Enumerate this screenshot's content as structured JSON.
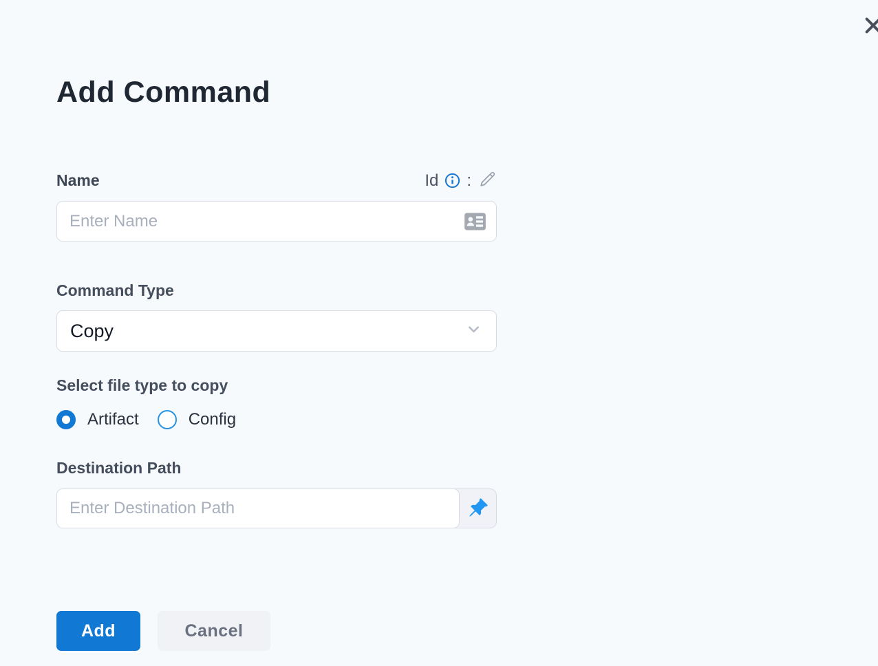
{
  "panel": {
    "title": "Add Command"
  },
  "form": {
    "name": {
      "label": "Name",
      "id_prefix": "Id",
      "id_separator": ":",
      "placeholder": "Enter Name",
      "value": ""
    },
    "command_type": {
      "label": "Command Type",
      "selected_value": "Copy"
    },
    "file_type": {
      "label": "Select file type to copy",
      "options": [
        {
          "label": "Artifact",
          "selected": true
        },
        {
          "label": "Config",
          "selected": false
        }
      ]
    },
    "destination_path": {
      "label": "Destination Path",
      "placeholder": "Enter Destination Path",
      "value": ""
    }
  },
  "actions": {
    "add": "Add",
    "cancel": "Cancel"
  },
  "icons": {
    "close": "close-icon (x)",
    "info": "info-circle-icon (blue outlined i)",
    "edit": "pencil-icon (gray outline)",
    "idcard": "idcard-icon (gray contact card suffix)",
    "chevron": "chevron-down-icon",
    "pushpin": "pushpin-icon (blue, input addon)"
  },
  "colors": {
    "background": "#f7fafd",
    "primary_blue": "#1178d4",
    "pin_blue": "#2196f3",
    "info_blue": "#1778d2",
    "title_text": "#1f2733",
    "label_text": "#3d4654",
    "placeholder_text": "#a9b0bd",
    "input_border": "#d9dde3",
    "cancel_bg": "#f1f2f5",
    "cancel_text": "#697080",
    "close_x": "#4a4f5c"
  }
}
